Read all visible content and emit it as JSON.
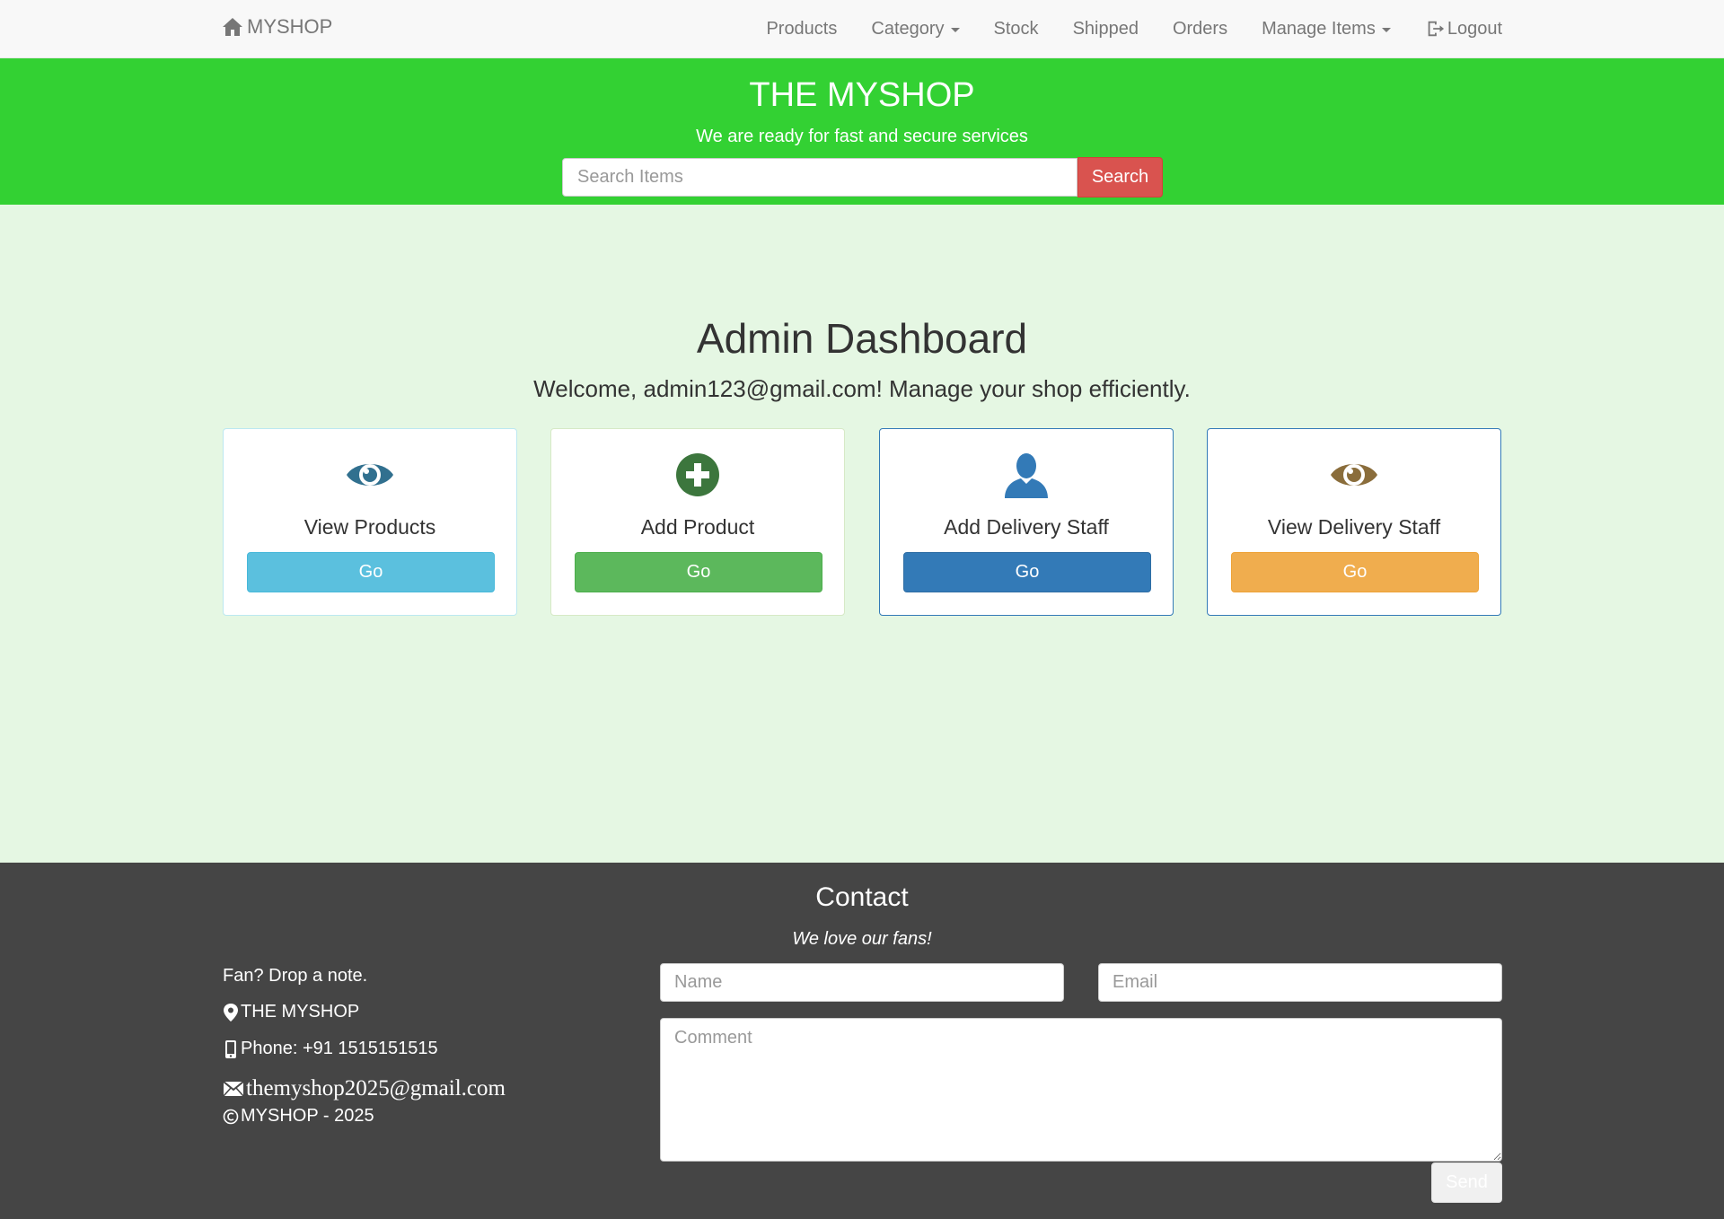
{
  "nav": {
    "brand": "MYSHOP",
    "items": [
      {
        "label": "Products"
      },
      {
        "label": "Category",
        "dropdown": true
      },
      {
        "label": "Stock"
      },
      {
        "label": "Shipped"
      },
      {
        "label": "Orders"
      },
      {
        "label": "Manage Items",
        "dropdown": true
      }
    ],
    "logout": "Logout"
  },
  "hero": {
    "title": "THE MYSHOP",
    "subtitle": "We are ready for fast and secure services",
    "search_placeholder": "Search Items",
    "search_button": "Search"
  },
  "dashboard": {
    "title": "Admin Dashboard",
    "welcome": "Welcome, admin123@gmail.com! Manage your shop efficiently.",
    "cards": [
      {
        "label": "View Products",
        "button": "Go",
        "icon": "eye-icon",
        "icon_color": "#31708f",
        "button_color": "#5bc0de"
      },
      {
        "label": "Add Product",
        "button": "Go",
        "icon": "plus-circle-icon",
        "icon_color": "#3c763d",
        "button_color": "#5cb85c"
      },
      {
        "label": "Add Delivery Staff",
        "button": "Go",
        "icon": "user-icon",
        "icon_color": "#337ab7",
        "button_color": "#337ab7"
      },
      {
        "label": "View Delivery Staff",
        "button": "Go",
        "icon": "eye-icon",
        "icon_color": "#8a6d3b",
        "button_color": "#f0ad4e"
      }
    ]
  },
  "footer": {
    "title": "Contact",
    "tagline": "We love our fans!",
    "note": "Fan? Drop a note.",
    "address": "THE MYSHOP",
    "phone": "Phone: +91 1515151515",
    "email": "themyshop2025@gmail.com",
    "copyright": "MYSHOP - 2025",
    "form": {
      "name_placeholder": "Name",
      "email_placeholder": "Email",
      "comment_placeholder": "Comment",
      "send_button": "Send"
    }
  },
  "colors": {
    "hero_bg": "#33d133",
    "page_bg": "#e5f7e3",
    "footer_bg": "#454545",
    "search_button": "#d9534f"
  }
}
